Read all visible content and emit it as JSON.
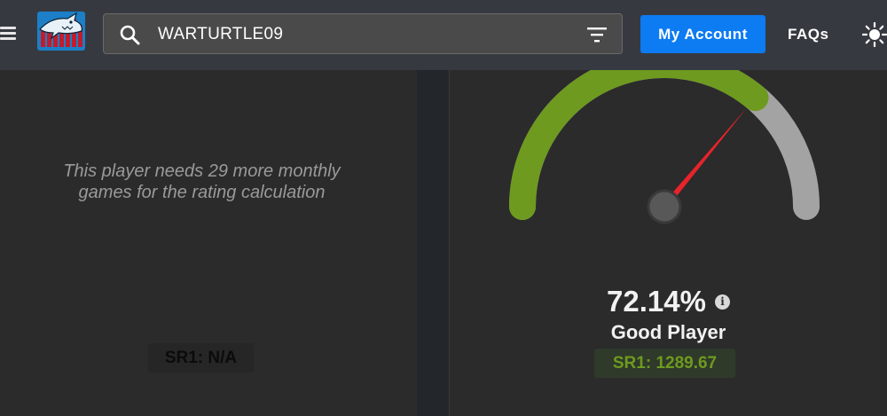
{
  "header": {
    "menu_icon": "hamburger-menu-icon",
    "logo_icon": "shark-logo",
    "search": {
      "value": "WARTURTLE09",
      "icon": "search-icon",
      "filter_icon": "filter-icon"
    },
    "account_label": "My Account",
    "faqs_label": "FAQs",
    "theme_icon": "sun-icon"
  },
  "left_card": {
    "notice": "This player needs 29 more monthly games for the rating calculation",
    "sr_label": "SR1: N/A"
  },
  "right_card": {
    "gauge_value_percent": 72.14,
    "percentage": "72.14%",
    "info_icon": "info-icon",
    "rating_label": "Good Player",
    "sr_label": "SR1: 1289.67"
  },
  "colors": {
    "topbar": "#363a40",
    "background": "#2b2b2b",
    "accent_blue": "#0d7bf2",
    "gauge_fill": "#6e9a1f",
    "gauge_track": "#a3a3a3",
    "needle": "#e8232a"
  }
}
